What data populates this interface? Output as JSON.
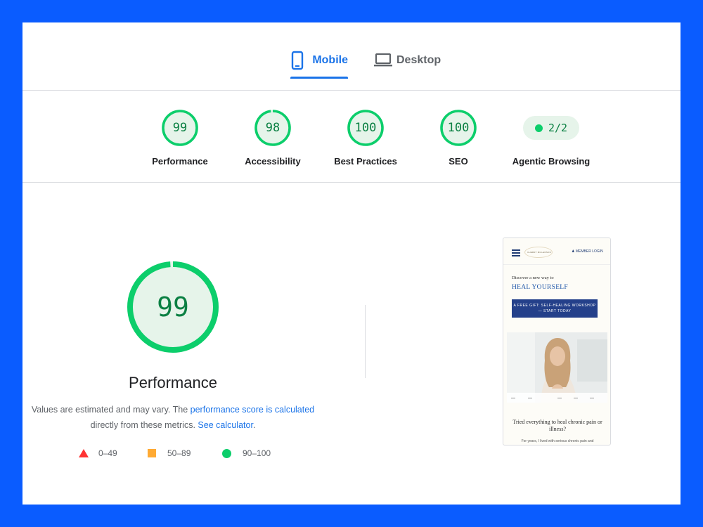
{
  "tabs": [
    {
      "label": "Mobile",
      "icon": "phone-icon",
      "active": true
    },
    {
      "label": "Desktop",
      "icon": "laptop-icon",
      "active": false
    }
  ],
  "categories": [
    {
      "score": "99",
      "label": "Performance"
    },
    {
      "score": "98",
      "label": "Accessibility"
    },
    {
      "score": "100",
      "label": "Best Practices"
    },
    {
      "score": "100",
      "label": "SEO"
    },
    {
      "score": "2/2",
      "label": "Agentic Browsing"
    }
  ],
  "performance": {
    "score": "99",
    "title": "Performance",
    "desc_text_1": "Values are estimated and may vary. The ",
    "desc_link_1": "performance score is calculated",
    "desc_text_2": " directly from these metrics. ",
    "desc_link_2": "See calculator",
    "desc_text_3": "."
  },
  "legend": [
    {
      "range": "0–49",
      "color": "#ff3333"
    },
    {
      "range": "50–89",
      "color": "#ffaa33"
    },
    {
      "range": "90–100",
      "color": "#0cce6b"
    }
  ],
  "screenshot": {
    "login": "MEMBER LOGIN",
    "logo_text": "CHERRY MILLERSON",
    "discover": "Discover a new way to",
    "heading": "HEAL YOURSELF",
    "cta": "A FREE GIFT: SELF-HEALING WORKSHOP — START TODAY",
    "tried": "Tried everything to heal chronic pain or illness?",
    "more": "For years, I lived with serious chronic pain and"
  },
  "colors": {
    "pass_green": "#0cce6b",
    "pass_text": "#0b8043",
    "pass_bg": "#e6f4ea",
    "accent_blue": "#1a73e8",
    "frame_blue": "#0a5cff"
  }
}
